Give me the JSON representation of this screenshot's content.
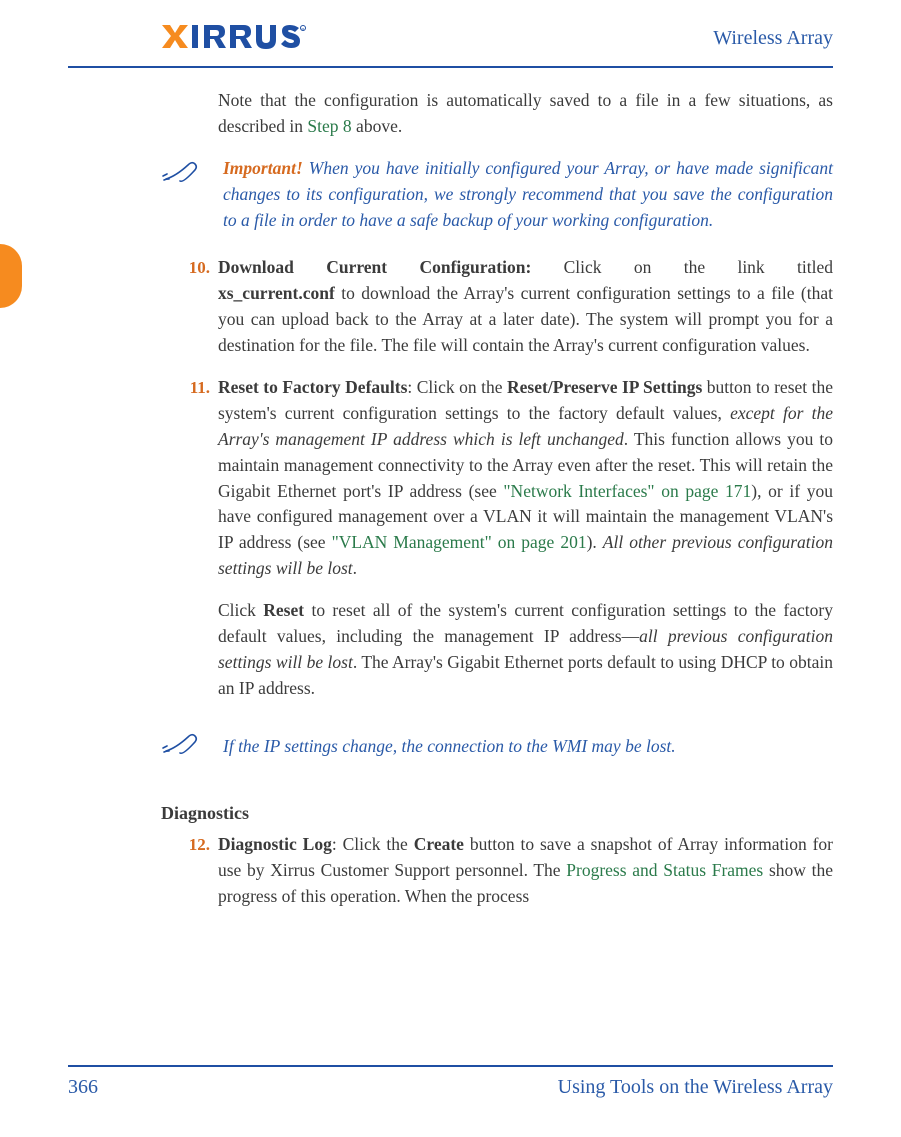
{
  "header": {
    "logo_brand": "XIRRUS",
    "right_text": "Wireless Array"
  },
  "intro": {
    "text_before_link": "Note that the configuration is automatically saved to a file in a few situations, as described in ",
    "link": "Step 8",
    "text_after_link": " above."
  },
  "important_note": {
    "label": "Important!",
    "text": " When you have initially configured your Array, or have made significant changes to its configuration, we strongly recommend that you save the configuration to a file in order to have a safe backup of your working configuration."
  },
  "item10": {
    "num": "10.",
    "title": "Download Current Configuration:",
    "after_title": " Click on the link titled ",
    "filename": "xs_current.conf",
    "rest": " to download the Array's current configuration settings to a file (that you can upload back to the Array at a later date). The system will prompt you for a destination for the file. The file will contain the Array's current configuration values."
  },
  "item11": {
    "num": "11.",
    "title": "Reset to Factory Defaults",
    "after_title": ": Click on the ",
    "button1": "Reset/Preserve IP Settings",
    "p1a": " button to reset the system's current configuration settings to the factory default values, ",
    "italic1": "except for the Array's management IP address which is left unchanged",
    "p1b": ". This function allows you to maintain management connectivity to the Array even after the reset. This will retain the Gigabit Ethernet port's IP address (see ",
    "ref1": "\"Network Interfaces\" on page 171",
    "p1c": "), or if you have configured management over a VLAN it will maintain the management VLAN's IP address (see ",
    "ref2": "\"VLAN Management\" on page 201",
    "p1d": "). ",
    "italic2": "All other previous configuration settings will be lost",
    "p1e": ".",
    "p2a": "Click ",
    "button2": "Reset",
    "p2b": " to reset all of the system's current configuration settings to the factory default values, including the management IP address—",
    "italic3": "all previous configuration settings will be lost",
    "p2c": ". The Array's Gigabit Ethernet ports default to using DHCP to obtain an IP address."
  },
  "ip_note": {
    "text": "If the IP settings change, the connection to the WMI may be lost."
  },
  "diagnostics": {
    "heading": "Diagnostics"
  },
  "item12": {
    "num": "12.",
    "title": "Diagnostic Log",
    "after_title": ": Click the ",
    "button": "Create",
    "p1a": " button to save a snapshot of Array information for use by Xirrus Customer Support personnel. The ",
    "ref": "Progress and Status Frames",
    "p1b": " show the progress of this operation. When the process"
  },
  "footer": {
    "page": "366",
    "section": "Using Tools on the Wireless Array"
  }
}
